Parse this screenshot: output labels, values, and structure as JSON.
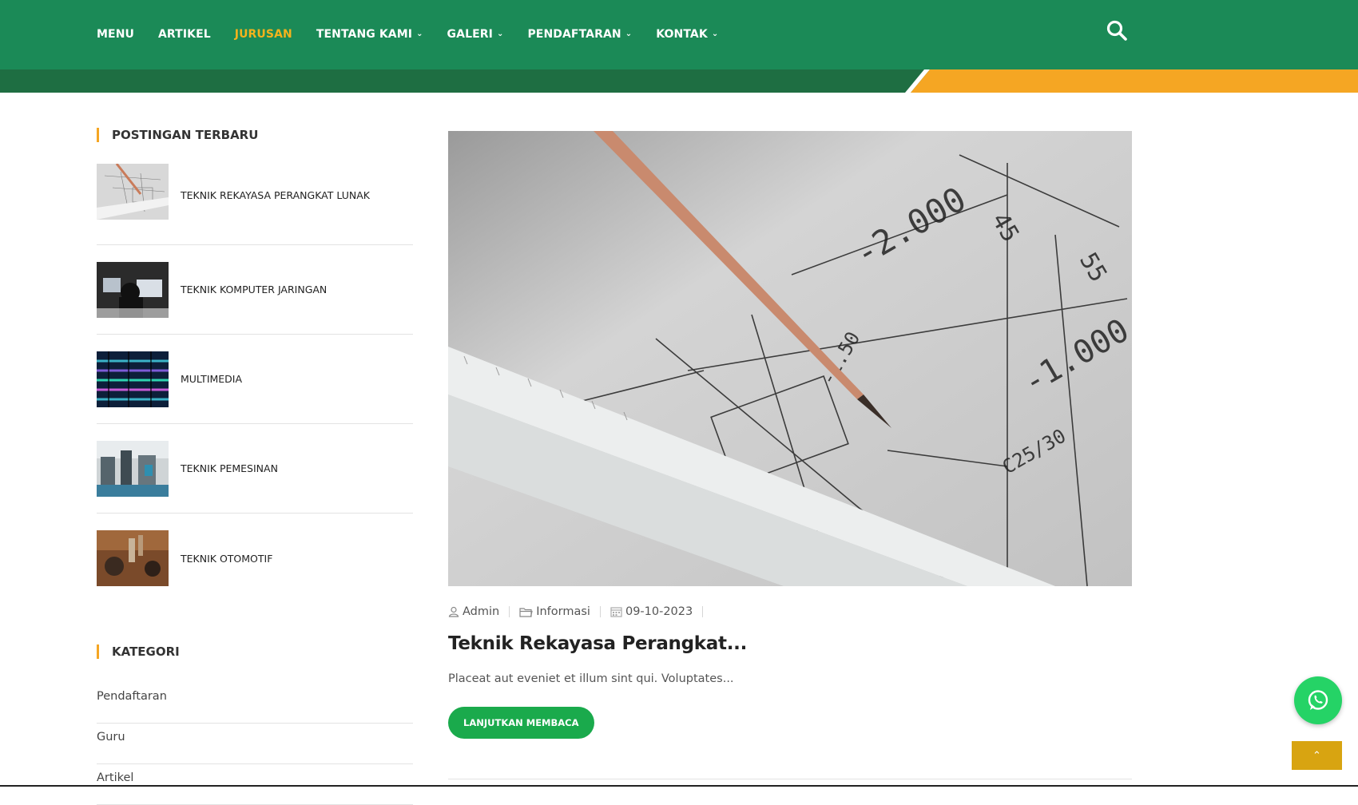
{
  "nav": {
    "items": [
      {
        "label": "MENU",
        "dropdown": false,
        "active": false
      },
      {
        "label": "ARTIKEL",
        "dropdown": false,
        "active": false
      },
      {
        "label": "JURUSAN",
        "dropdown": false,
        "active": true
      },
      {
        "label": "TENTANG KAMI",
        "dropdown": true,
        "active": false
      },
      {
        "label": "GALERI",
        "dropdown": true,
        "active": false
      },
      {
        "label": "PENDAFTARAN",
        "dropdown": true,
        "active": false
      },
      {
        "label": "KONTAK",
        "dropdown": true,
        "active": false
      }
    ],
    "search_icon": "search-icon"
  },
  "sidebar": {
    "recent_title": "POSTINGAN TERBARU",
    "recent_posts": [
      {
        "title": "TEKNIK REKAYASA PERANGKAT LUNAK"
      },
      {
        "title": "TEKNIK KOMPUTER JARINGAN"
      },
      {
        "title": "MULTIMEDIA"
      },
      {
        "title": "TEKNIK PEMESINAN"
      },
      {
        "title": "TEKNIK OTOMOTIF"
      }
    ],
    "category_title": "KATEGORI",
    "categories": [
      "Pendaftaran",
      "Guru",
      "Artikel"
    ]
  },
  "post": {
    "author": "Admin",
    "category": "Informasi",
    "date": "09-10-2023",
    "title": "Teknik Rekayasa Perangkat...",
    "excerpt": "Placeat aut eveniet et illum sint qui. Voluptates...",
    "read_more": "LANJUTKAN MEMBACA"
  },
  "colors": {
    "nav_bg": "#1b8a57",
    "active": "#f5b31c",
    "accent": "#f5a623",
    "button": "#1aaa4c",
    "whatsapp": "#25d366",
    "back_to_top": "#d8a411"
  },
  "floating": {
    "whatsapp_icon": "whatsapp-icon",
    "top_icon": "double-chevron-up-icon"
  }
}
